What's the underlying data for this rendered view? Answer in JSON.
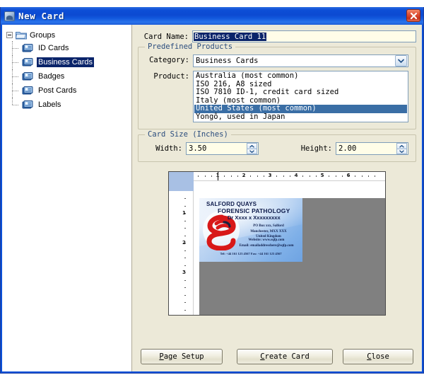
{
  "window": {
    "title": "New Card",
    "icon": "card-window-icon",
    "close_label": "×"
  },
  "tree": {
    "root": {
      "label": "Groups",
      "icon": "folder-icon",
      "expanded": true
    },
    "items": [
      {
        "label": "ID Cards",
        "icon": "card-icon",
        "selected": false
      },
      {
        "label": "Business Cards",
        "icon": "card-icon",
        "selected": true
      },
      {
        "label": "Badges",
        "icon": "card-icon",
        "selected": false
      },
      {
        "label": "Post Cards",
        "icon": "card-icon",
        "selected": false
      },
      {
        "label": "Labels",
        "icon": "card-icon",
        "selected": false
      }
    ]
  },
  "form": {
    "card_name_label": "Card Name:",
    "card_name_value": "Business Card 11",
    "predefined_products": {
      "title": "Predefined Products",
      "category_label": "Category:",
      "category_value": "Business Cards",
      "product_label": "Product:",
      "products": [
        "Australia (most common)",
        "ISO 216, A8 sized",
        "ISO 7810 ID-1, credit card sized",
        "Italy (most common)",
        "United States (most common)",
        "Yongô, used in Japan"
      ],
      "selected_product_index": 4
    },
    "card_size": {
      "title": "Card Size (Inches)",
      "width_label": "Width:",
      "width_value": "3.50",
      "height_label": "Height:",
      "height_value": "2.00"
    }
  },
  "preview": {
    "ruler_h_numbers": [
      "1",
      "2",
      "3",
      "4",
      "5",
      "6"
    ],
    "ruler_v_numbers": [
      "1",
      "2",
      "3"
    ],
    "card": {
      "line1": "SALFORD QUAYS",
      "line2": "FORENSIC PATHOLOGY",
      "line3": "Dr Xxxx x Xxxxxxxxx",
      "address": "PO Box xxx, Salford\nManchester, MXX XXX\nUnited Kingdom",
      "website": "Website:  www.sqfp.com",
      "email": "Email:  emailaddresshere@sqfp.com",
      "telfax": "Tel:  +44 161 123 4567     Fax:  +44 161 123 4567"
    }
  },
  "buttons": {
    "page_setup": {
      "pre": "",
      "accel": "P",
      "post": "age Setup"
    },
    "create_card": {
      "pre": "",
      "accel": "C",
      "post": "reate Card"
    },
    "close": {
      "pre": "",
      "accel": "C",
      "post": "lose"
    }
  },
  "colors": {
    "titlebar_blue": "#0c4ad2",
    "dialog_bg": "#ece9d8",
    "selection_blue": "#0a246a",
    "list_selection": "#3a6ea5",
    "field_cream": "#fffde8",
    "page_gray": "#808080",
    "close_red": "#c5301c"
  }
}
